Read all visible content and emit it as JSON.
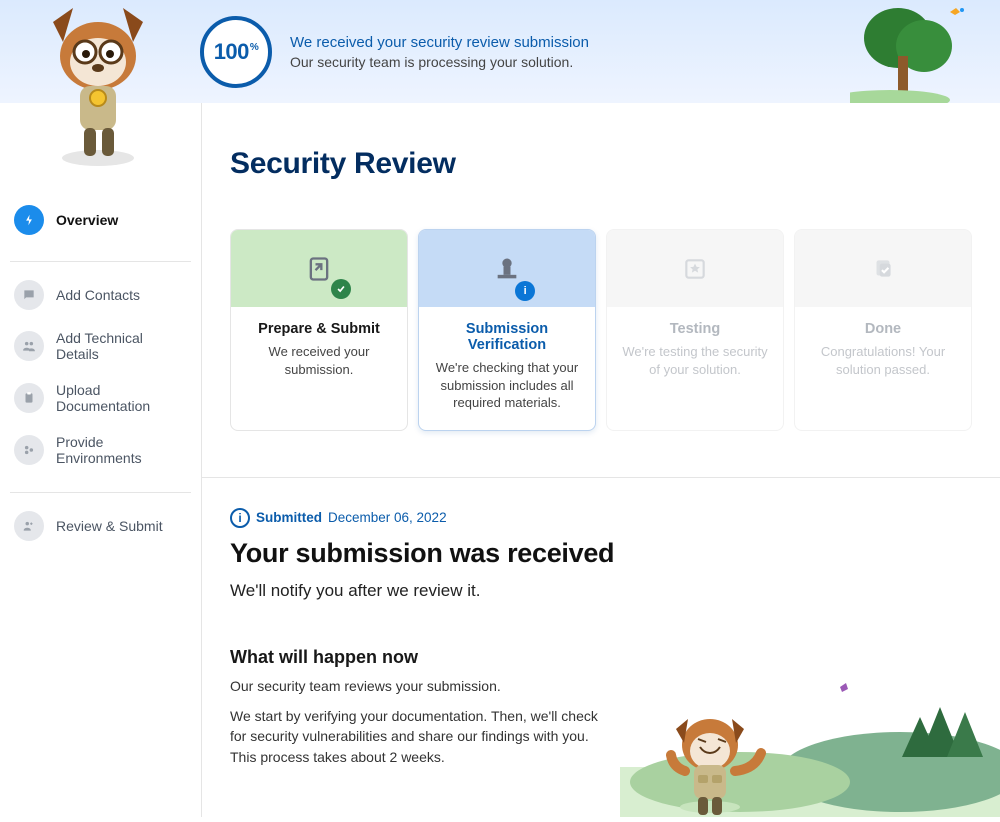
{
  "banner": {
    "progress_pct": "100",
    "title": "We received your security review submission",
    "subtitle": "Our security team is processing your solution."
  },
  "sidebar": {
    "overview": "Overview",
    "items": [
      "Add Contacts",
      "Add Technical Details",
      "Upload Documentation",
      "Provide Environments"
    ],
    "review": "Review & Submit"
  },
  "page": {
    "heading": "Security Review"
  },
  "cards": [
    {
      "title": "Prepare & Submit",
      "desc": "We received your submission."
    },
    {
      "title": "Submission Verification",
      "desc": "We're checking that your submission includes all required materials."
    },
    {
      "title": "Testing",
      "desc": "We're testing the security of your solution."
    },
    {
      "title": "Done",
      "desc": "Congratulations! Your solution passed."
    }
  ],
  "status": {
    "word": "Submitted",
    "date": "December 06, 2022",
    "heading": "Your submission was received",
    "sub": "We'll notify you after we review it."
  },
  "what": {
    "heading": "What will happen now",
    "p1": "Our security team reviews your submission.",
    "p2": "We start by verifying your documentation. Then, we'll check for security vulnerabilities and share our findings with you. This process takes about 2 weeks."
  }
}
